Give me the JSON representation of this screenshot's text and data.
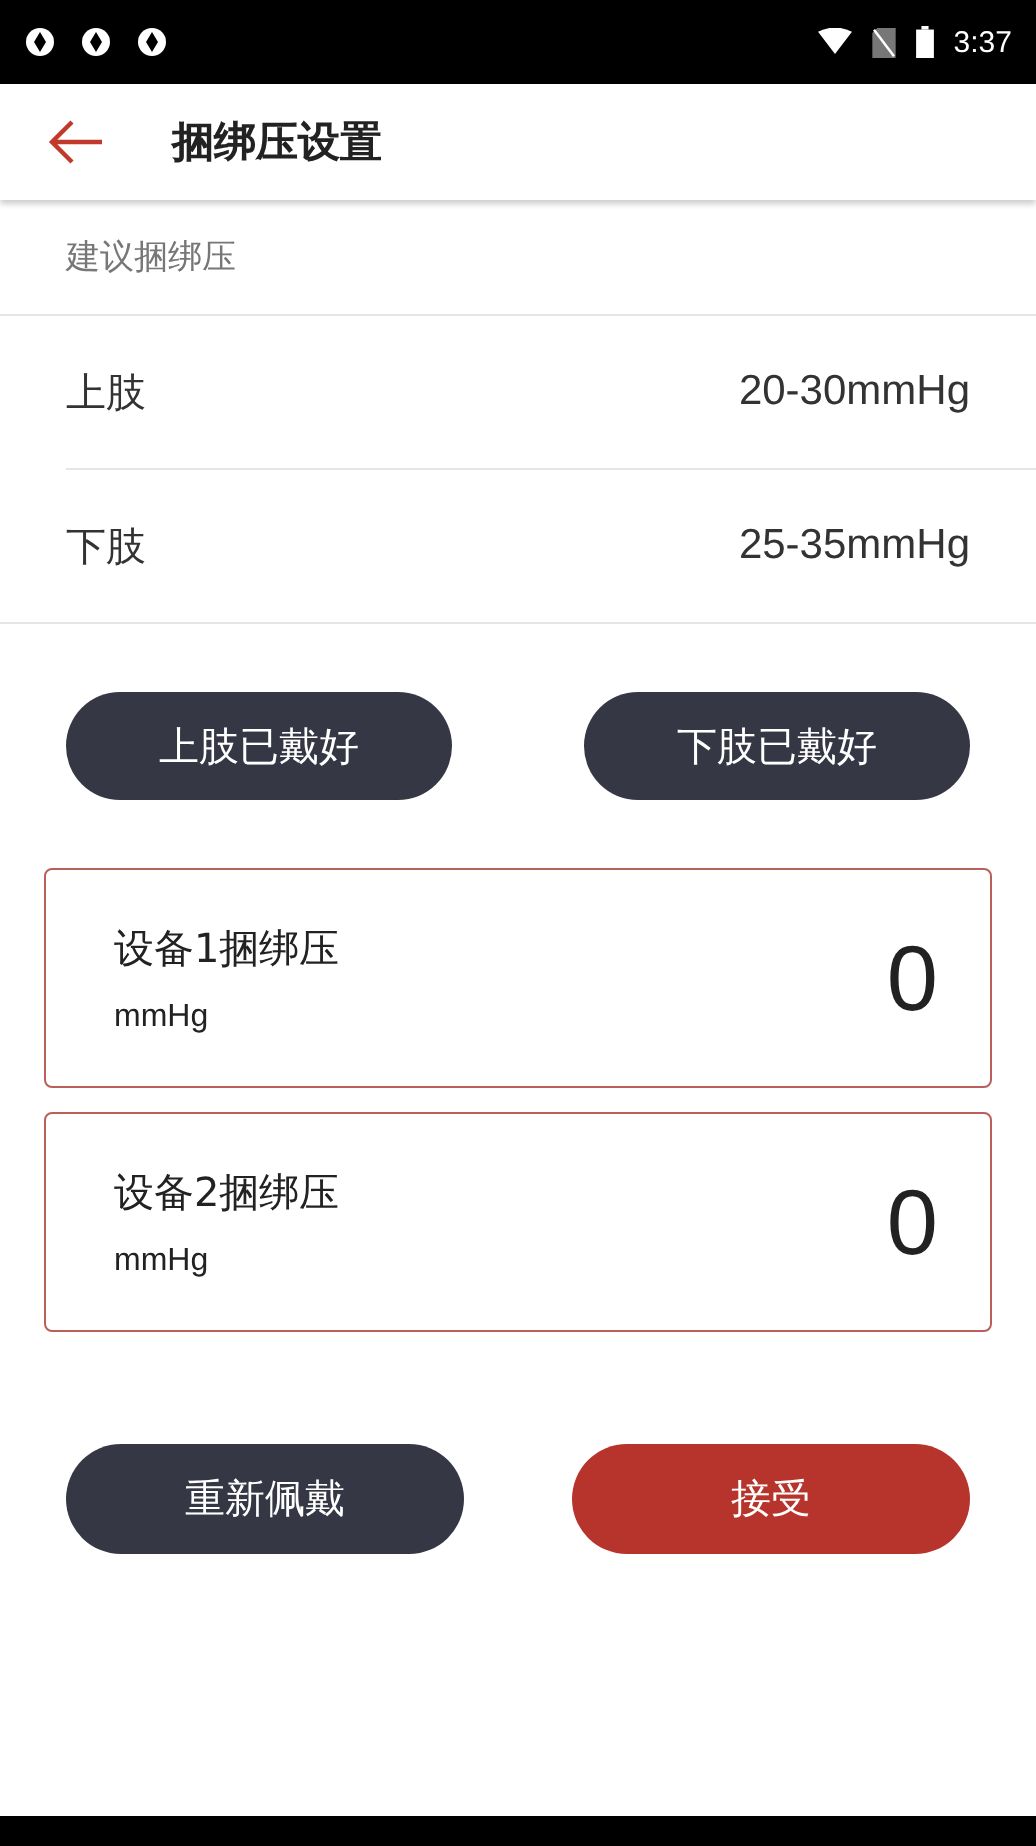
{
  "status_bar": {
    "time": "3:37"
  },
  "app_bar": {
    "title": "捆绑压设置"
  },
  "recommended": {
    "heading": "建议捆绑压",
    "rows": [
      {
        "label": "上肢",
        "value": "20-30mmHg"
      },
      {
        "label": "下肢",
        "value": "25-35mmHg"
      }
    ]
  },
  "wear_buttons": [
    "上肢已戴好",
    "下肢已戴好"
  ],
  "devices": [
    {
      "label": "设备1捆绑压",
      "unit": "mmHg",
      "value": "0"
    },
    {
      "label": "设备2捆绑压",
      "unit": "mmHg",
      "value": "0"
    }
  ],
  "actions": [
    {
      "label": "重新佩戴",
      "kind": "secondary"
    },
    {
      "label": "接受",
      "kind": "primary"
    }
  ]
}
